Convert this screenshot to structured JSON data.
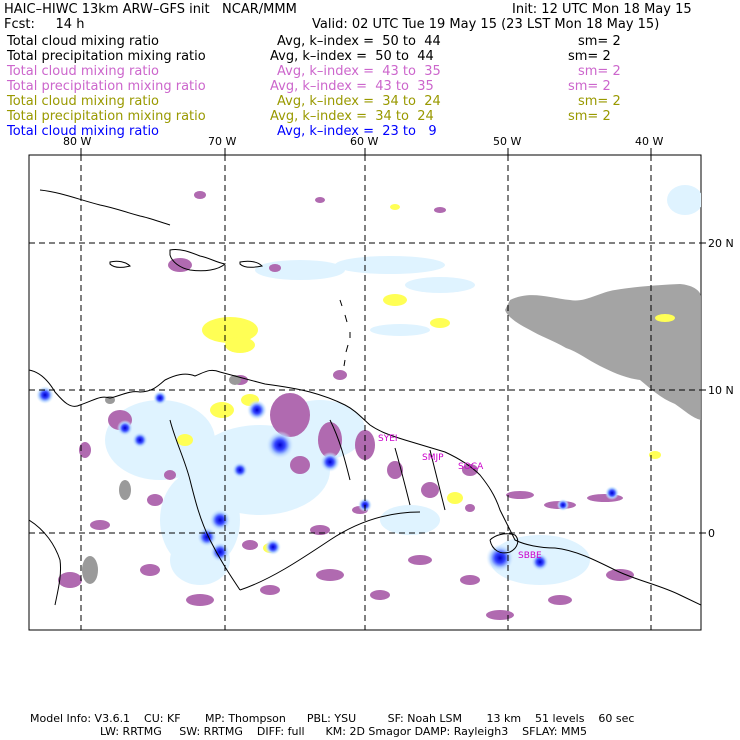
{
  "header": {
    "title_left": "HAIC–HIWC 13km ARW–GFS init   NCAR/MMM",
    "init": "Init: 12 UTC Mon 18 May 15",
    "fcst_label": "Fcst:     14 h",
    "valid": "Valid: 02 UTC Tue 19 May 15 (23 LST Mon 18 May 15)"
  },
  "fields": [
    {
      "name": "Total cloud mixing ratio",
      "avg": "Avg, k–index =  50 to  44",
      "sm": "sm= 2",
      "color": "#000000"
    },
    {
      "name": "Total precipitation mixing ratio",
      "avg": "Avg, k–index =  50 to  44",
      "sm": "sm= 2",
      "color": "#000000"
    },
    {
      "name": "Total cloud mixing ratio",
      "avg": "Avg, k–index =  43 to  35",
      "sm": "sm= 2",
      "color": "#cc66cc"
    },
    {
      "name": "Total precipitation mixing ratio",
      "avg": "Avg, k–index =  43 to  35",
      "sm": "sm= 2",
      "color": "#cc66cc"
    },
    {
      "name": "Total cloud mixing ratio",
      "avg": "Avg, k–index =  34 to  24",
      "sm": "sm= 2",
      "color": "#999900"
    },
    {
      "name": "Total precipitation mixing ratio",
      "avg": "Avg, k–index =  34 to  24",
      "sm": "sm= 2",
      "color": "#999900"
    },
    {
      "name": "Total cloud mixing ratio",
      "avg": "Avg, k–index =  23 to   9",
      "sm": "",
      "color": "#0000ff"
    }
  ],
  "map": {
    "lon_labels": [
      "80 W",
      "70 W",
      "60 W",
      "50 W",
      "40 W"
    ],
    "lat_labels": [
      "20 N",
      "10 N",
      "0"
    ],
    "stations": [
      "SYEI",
      "SMJP",
      "SOCA",
      "SBBE"
    ],
    "colors": {
      "cloud_mid": "#b06ab0",
      "cloud_low": "#ffff55",
      "cloud_high": "#dff3ff",
      "precip_core": "#1a1aff",
      "precip_upper": "#9a9a9a"
    }
  },
  "footer": {
    "line1": "Model Info: V3.6.1    CU: KF       MP: Thompson      PBL: YSU         SF: Noah LSM       13 km    51 levels    60 sec",
    "line2": "LW: RRTMG     SW: RRTMG    DIFF: full      KM: 2D Smagor DAMP: Rayleigh3    SFLAY: MM5"
  }
}
